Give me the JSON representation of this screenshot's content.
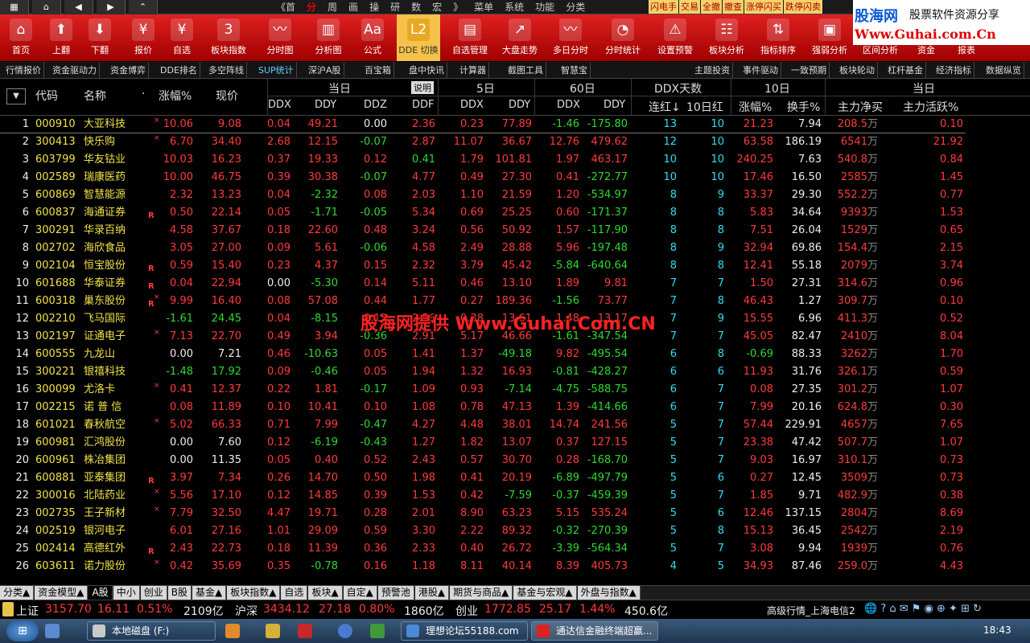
{
  "topbar": {
    "nav": [
      "《首",
      "分",
      "周",
      "画",
      "操",
      "研",
      "数",
      "宏",
      "》",
      "菜单",
      "系统",
      "功能",
      "分类"
    ],
    "nav_current": "分",
    "buttons": [
      "闪电手",
      "交易",
      "全撤",
      "撤查",
      "涨停闪买",
      "跌停闪卖"
    ]
  },
  "logo": {
    "line1": "股海网",
    "line2": "股票软件资源分享",
    "line3": "Www.Guhai.com.Cn"
  },
  "toolbar": [
    {
      "label": "首页",
      "icon": "home-icon",
      "glyph": "⌂"
    },
    {
      "label": "上翻",
      "icon": "arrow-up-icon",
      "glyph": "⬆"
    },
    {
      "label": "下翻",
      "icon": "arrow-down-icon",
      "glyph": "⬇"
    },
    {
      "label": "报价",
      "icon": "quote-icon",
      "glyph": "¥"
    },
    {
      "label": "自选",
      "icon": "yen-icon",
      "glyph": "¥"
    },
    {
      "label": "板块指数",
      "icon": "calendar-icon",
      "glyph": "3"
    },
    {
      "label": "分时图",
      "icon": "intraday-chart-icon",
      "glyph": "〰"
    },
    {
      "label": "分析图",
      "icon": "candle-chart-icon",
      "glyph": "▥"
    },
    {
      "label": "公式",
      "icon": "formula-icon",
      "glyph": "Aa"
    },
    {
      "label": "DDE 切换",
      "icon": "l2-icon",
      "glyph": "L2"
    },
    {
      "label": "自选管理",
      "icon": "folder-icon",
      "glyph": "▤"
    },
    {
      "label": "大盘走势",
      "icon": "trend-icon",
      "glyph": "↗"
    },
    {
      "label": "多日分时",
      "icon": "multi-day-icon",
      "glyph": "〰"
    },
    {
      "label": "分时统计",
      "icon": "pie-chart-icon",
      "glyph": "◔"
    },
    {
      "label": "设置预警",
      "icon": "warning-icon",
      "glyph": "⚠"
    },
    {
      "label": "板块分析",
      "icon": "sector-analysis-icon",
      "glyph": "☷"
    },
    {
      "label": "指标排序",
      "icon": "sort-icon",
      "glyph": "⇅"
    },
    {
      "label": "强弱分析",
      "icon": "strength-icon",
      "glyph": "▣"
    },
    {
      "label": "区间分析",
      "icon": "range-icon",
      "glyph": "◫"
    },
    {
      "label": "资金",
      "icon": "funds-icon",
      "glyph": "$"
    },
    {
      "label": "报表",
      "icon": "report-icon",
      "glyph": "▦"
    }
  ],
  "subbar": [
    "行情报价",
    "资金驱动力",
    "资金博弈",
    "DDE排名",
    "多空阵线",
    "SUP统计",
    "深沪A股",
    "百宝箱",
    "盘中快讯",
    "计算器",
    "截图工具",
    "智慧宝",
    "主题投资",
    "事件驱动",
    "一致预期",
    "板块轮动",
    "杠杆基金",
    "经济指标",
    "数据纵览"
  ],
  "header": {
    "code": "代码",
    "name": "名称",
    "dot": "·",
    "pct": "涨幅%",
    "price": "现价",
    "today": "当日",
    "explain": "说明",
    "d5": "5日",
    "d60": "60日",
    "ddxdays": "DDX天数",
    "d10": "10日",
    "today2": "当日",
    "ddx": "DDX",
    "ddy": "DDY",
    "ddz": "DDZ",
    "ddf": "DDF",
    "ddx5": "DDX",
    "ddy5": "DDY",
    "ddx60": "DDX",
    "ddy60": "DDY",
    "lianhong": "连红↓",
    "hong10": "10日红",
    "pct10": "涨幅%",
    "turn10": "换手%",
    "netbuy": "主力净买",
    "active": "主力活跃%"
  },
  "rows": [
    [
      "1",
      "000910",
      "大亚科技",
      "×",
      "",
      "10.06",
      "9.08",
      "0.04",
      "49.21",
      "0.00",
      "2.36",
      "0.23",
      "77.89",
      "-1.46",
      "-175.80",
      "13",
      "10",
      "21.23",
      "7.94",
      "208.5",
      "万",
      "0.10"
    ],
    [
      "2",
      "300413",
      "快乐购",
      "×",
      "",
      "6.70",
      "34.40",
      "2.68",
      "12.15",
      "-0.07",
      "2.87",
      "11.07",
      "36.67",
      "12.76",
      "479.62",
      "12",
      "10",
      "63.58",
      "186.19",
      "6541",
      "万",
      "21.92"
    ],
    [
      "3",
      "603799",
      "华友钴业",
      "",
      "",
      "10.03",
      "16.23",
      "0.37",
      "19.33",
      "0.12",
      "0.41",
      "1.79",
      "101.81",
      "1.97",
      "463.17",
      "10",
      "10",
      "240.25",
      "7.63",
      "540.8",
      "万",
      "0.84"
    ],
    [
      "4",
      "002589",
      "瑞康医药",
      "",
      "",
      "10.00",
      "46.75",
      "0.39",
      "30.38",
      "-0.07",
      "4.77",
      "0.49",
      "27.30",
      "0.41",
      "-272.77",
      "10",
      "10",
      "17.46",
      "16.50",
      "2585",
      "万",
      "1.45"
    ],
    [
      "5",
      "600869",
      "智慧能源",
      "",
      "",
      "2.32",
      "13.23",
      "0.04",
      "-2.32",
      "0.08",
      "2.03",
      "1.10",
      "21.59",
      "1.20",
      "-534.97",
      "8",
      "9",
      "33.37",
      "29.30",
      "552.2",
      "万",
      "0.77"
    ],
    [
      "6",
      "600837",
      "海通证券",
      "",
      "R",
      "0.50",
      "22.14",
      "0.05",
      "-1.71",
      "-0.05",
      "5.34",
      "0.69",
      "25.25",
      "0.60",
      "-171.37",
      "8",
      "8",
      "5.83",
      "34.64",
      "9393",
      "万",
      "1.53"
    ],
    [
      "7",
      "300291",
      "华录百纳",
      "",
      "",
      "4.58",
      "37.67",
      "0.18",
      "22.60",
      "0.48",
      "3.24",
      "0.56",
      "50.92",
      "1.57",
      "-117.90",
      "8",
      "8",
      "7.51",
      "26.04",
      "1529",
      "万",
      "0.65"
    ],
    [
      "8",
      "002702",
      "海欣食品",
      "",
      "",
      "3.05",
      "27.00",
      "0.09",
      "5.61",
      "-0.06",
      "4.58",
      "2.49",
      "28.88",
      "5.96",
      "-197.48",
      "8",
      "9",
      "32.94",
      "69.86",
      "154.4",
      "万",
      "2.15"
    ],
    [
      "9",
      "002104",
      "恒宝股份",
      "",
      "R",
      "0.59",
      "15.40",
      "0.23",
      "4.37",
      "0.15",
      "2.32",
      "3.79",
      "45.42",
      "-5.84",
      "-640.64",
      "8",
      "8",
      "12.41",
      "55.18",
      "2079",
      "万",
      "3.74"
    ],
    [
      "10",
      "601688",
      "华泰证券",
      "",
      "R",
      "0.04",
      "22.94",
      "0.00",
      "-5.30",
      "0.14",
      "5.11",
      "0.46",
      "13.10",
      "1.89",
      "9.81",
      "7",
      "7",
      "1.50",
      "27.31",
      "314.6",
      "万",
      "0.96"
    ],
    [
      "11",
      "600318",
      "巢东股份",
      "×",
      "R",
      "9.99",
      "16.40",
      "0.08",
      "57.08",
      "0.44",
      "1.77",
      "0.27",
      "189.36",
      "-1.56",
      "73.77",
      "7",
      "8",
      "46.43",
      "1.27",
      "309.7",
      "万",
      "0.10"
    ],
    [
      "12",
      "002210",
      "飞马国际",
      "",
      "",
      "-1.61",
      "24.45",
      "0.04",
      "-8.15",
      "0.12",
      "2.56",
      "0.38",
      "13.61",
      "1.48",
      "13.17",
      "7",
      "9",
      "15.55",
      "6.96",
      "411.3",
      "万",
      "0.52"
    ],
    [
      "13",
      "002197",
      "证通电子",
      "×",
      "",
      "7.13",
      "22.70",
      "0.49",
      "3.94",
      "-0.36",
      "2.91",
      "5.17",
      "46.66",
      "-1.61",
      "-347.54",
      "7",
      "7",
      "45.05",
      "82.47",
      "2410",
      "万",
      "8.04"
    ],
    [
      "14",
      "600555",
      "九龙山",
      "",
      "",
      "0.00",
      "7.21",
      "0.46",
      "-10.63",
      "0.05",
      "1.41",
      "1.37",
      "-49.18",
      "9.82",
      "-495.54",
      "6",
      "8",
      "-0.69",
      "88.33",
      "3262",
      "万",
      "1.70"
    ],
    [
      "15",
      "300221",
      "银禧科技",
      "",
      "",
      "-1.48",
      "17.92",
      "0.09",
      "-0.46",
      "0.05",
      "1.94",
      "1.32",
      "16.93",
      "-0.81",
      "-428.27",
      "6",
      "6",
      "11.93",
      "31.76",
      "326.1",
      "万",
      "0.59"
    ],
    [
      "16",
      "300099",
      "尤洛卡",
      "×",
      "",
      "0.41",
      "12.37",
      "0.22",
      "1.81",
      "-0.17",
      "1.09",
      "0.93",
      "-7.14",
      "-4.75",
      "-588.75",
      "6",
      "7",
      "0.08",
      "27.35",
      "301.2",
      "万",
      "1.07"
    ],
    [
      "17",
      "002215",
      "诺 普 信",
      "",
      "",
      "0.08",
      "11.89",
      "0.10",
      "10.41",
      "0.10",
      "1.08",
      "0.78",
      "47.13",
      "1.39",
      "-414.66",
      "6",
      "7",
      "7.99",
      "20.16",
      "624.8",
      "万",
      "0.30"
    ],
    [
      "18",
      "601021",
      "春秋航空",
      "×",
      "",
      "5.02",
      "66.33",
      "0.71",
      "7.99",
      "-0.47",
      "4.27",
      "4.48",
      "38.01",
      "14.74",
      "241.56",
      "5",
      "7",
      "57.44",
      "229.91",
      "4657",
      "万",
      "7.65"
    ],
    [
      "19",
      "600981",
      "汇鸿股份",
      "",
      "",
      "0.00",
      "7.60",
      "0.12",
      "-6.19",
      "-0.43",
      "1.27",
      "1.82",
      "13.07",
      "0.37",
      "127.15",
      "5",
      "7",
      "23.38",
      "47.42",
      "507.7",
      "万",
      "1.07"
    ],
    [
      "20",
      "600961",
      "株冶集团",
      "",
      "",
      "0.00",
      "11.35",
      "0.05",
      "0.40",
      "0.52",
      "2.43",
      "0.57",
      "30.70",
      "0.28",
      "-168.70",
      "5",
      "7",
      "9.03",
      "16.97",
      "310.1",
      "万",
      "0.73"
    ],
    [
      "21",
      "600881",
      "亚泰集团",
      "",
      "R",
      "3.97",
      "7.34",
      "0.26",
      "14.70",
      "0.50",
      "1.98",
      "0.41",
      "20.19",
      "-6.89",
      "-497.79",
      "5",
      "6",
      "0.27",
      "12.45",
      "3509",
      "万",
      "0.73"
    ],
    [
      "22",
      "300016",
      "北陆药业",
      "×",
      "",
      "5.56",
      "17.10",
      "0.12",
      "14.85",
      "0.39",
      "1.53",
      "0.42",
      "-7.59",
      "-0.37",
      "-459.39",
      "5",
      "7",
      "1.85",
      "9.71",
      "482.9",
      "万",
      "0.38"
    ],
    [
      "23",
      "002735",
      "王子新材",
      "×",
      "",
      "7.79",
      "32.50",
      "4.47",
      "19.71",
      "0.28",
      "2.01",
      "8.90",
      "63.23",
      "5.15",
      "535.24",
      "5",
      "6",
      "12.46",
      "137.15",
      "2804",
      "万",
      "8.69"
    ],
    [
      "24",
      "002519",
      "银河电子",
      "",
      "",
      "6.01",
      "27.16",
      "1.01",
      "29.09",
      "0.59",
      "3.30",
      "2.22",
      "89.32",
      "-0.32",
      "-270.39",
      "5",
      "8",
      "15.13",
      "36.45",
      "2542",
      "万",
      "2.19"
    ],
    [
      "25",
      "002414",
      "高德红外",
      "",
      "R",
      "2.43",
      "22.73",
      "0.18",
      "11.39",
      "0.36",
      "2.33",
      "0.40",
      "26.72",
      "-3.39",
      "-564.34",
      "5",
      "7",
      "3.08",
      "9.94",
      "1939",
      "万",
      "0.76"
    ],
    [
      "26",
      "603611",
      "诺力股份",
      "×",
      "",
      "0.42",
      "35.69",
      "0.35",
      "-0.78",
      "0.16",
      "1.18",
      "8.11",
      "40.14",
      "8.39",
      "405.73",
      "4",
      "5",
      "34.93",
      "87.46",
      "259.0",
      "万",
      "4.43"
    ]
  ],
  "watermark": "股海网提供 Www.Guhai.Com.CN",
  "tabs": [
    "分类▲",
    "资金模型▲",
    "A股",
    "中小",
    "创业",
    "B股",
    "基金▲",
    "板块指数▲",
    "自选",
    "板块▲",
    "自定▲",
    "预警池",
    "港股▲",
    "期货与商品▲",
    "基金与宏观▲",
    "外盘与指数▲"
  ],
  "tabs_current": "A股",
  "ticker": {
    "sh_label": "上证",
    "sh_val": "3157.70",
    "sh_chg": "16.11",
    "sh_pct": "0.51%",
    "sh_amt": "2109亿",
    "hs_label": "沪深",
    "hs_val": "3434.12",
    "hs_chg": "27.18",
    "hs_pct": "0.80%",
    "hs_amt": "1860亿",
    "cy_label": "创业",
    "cy_val": "1772.85",
    "cy_chg": "25.17",
    "cy_pct": "1.44%",
    "cy_amt": "450.6亿",
    "status": "高级行情_上海电信2"
  },
  "taskbar": {
    "items": [
      "本地磁盘 (F:)",
      "理想论坛55188.com",
      "通达信金融终端超赢..."
    ],
    "clock": "18:43"
  },
  "colors": {
    "up": "#ff3b3b",
    "down": "#2fd92f",
    "toolbar": "#c81414"
  }
}
